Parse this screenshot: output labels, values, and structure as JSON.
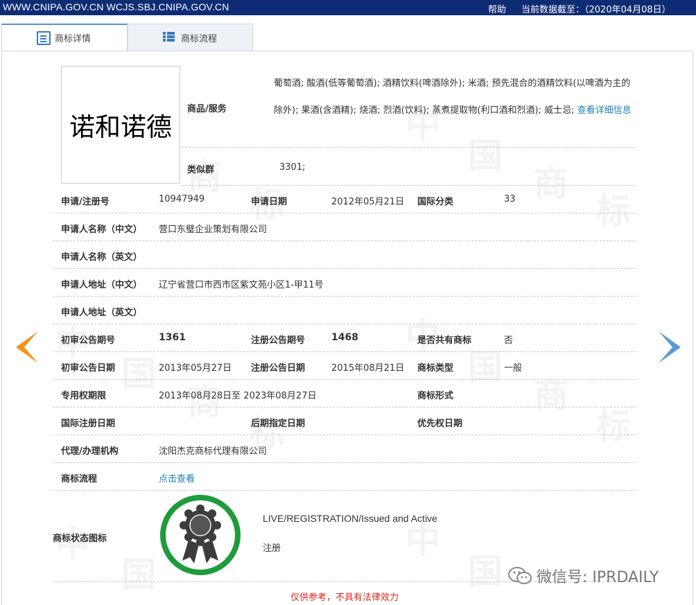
{
  "topbar": {
    "domain": "WWW.CNIPA.GOV.CN WCJS.SBJ.CNIPA.GOV.CN",
    "help": "帮助",
    "as_of": "当前数据截至：（2020年04月08日）"
  },
  "tabs": [
    {
      "label": "商标详情",
      "icon": "document-icon",
      "active": true
    },
    {
      "label": "商标流程",
      "icon": "list-icon",
      "active": false
    }
  ],
  "mark": {
    "text": "诺和诺德"
  },
  "goods": {
    "label": "商品/服务",
    "text": "葡萄酒; 酸酒(低等葡萄酒); 酒精饮料(啤酒除外); 米酒; 预先混合的酒精饮料(以啤酒为主的除外); 果酒(含酒精); 烧酒; 烈酒(饮料); 蒸煮提取物(利口酒和烈酒); 威士忌;",
    "more_link": "查看详细信息"
  },
  "similar_group": {
    "label": "类似群",
    "value": "3301;"
  },
  "fields": {
    "reg_no": {
      "label": "申请/注册号",
      "value": "10947949"
    },
    "app_date": {
      "label": "申请日期",
      "value": "2012年05月21日"
    },
    "intl_class": {
      "label": "国际分类",
      "value": "33"
    },
    "applicant_cn": {
      "label": "申请人名称（中文）",
      "value": "营口东璧企业策划有限公司"
    },
    "applicant_en": {
      "label": "申请人名称（英文）",
      "value": ""
    },
    "address_cn": {
      "label": "申请人地址（中文）",
      "value": "辽宁省营口市西市区紫文苑小区1-甲11号"
    },
    "address_en": {
      "label": "申请人地址（英文）",
      "value": ""
    },
    "prelim_pub_no": {
      "label": "初审公告期号",
      "value": "1361"
    },
    "reg_pub_no": {
      "label": "注册公告期号",
      "value": "1468"
    },
    "shared": {
      "label": "是否共有商标",
      "value": "否"
    },
    "prelim_pub_date": {
      "label": "初审公告日期",
      "value": "2013年05月27日"
    },
    "reg_pub_date": {
      "label": "注册公告日期",
      "value": "2015年08月21日"
    },
    "mark_type": {
      "label": "商标类型",
      "value": "一般"
    },
    "exclusive_period": {
      "label": "专用权期限",
      "value": "2013年08月28日至 2023年08月27日"
    },
    "mark_form": {
      "label": "商标形式",
      "value": ""
    },
    "intl_reg_date": {
      "label": "国际注册日期",
      "value": ""
    },
    "later_designation_date": {
      "label": "后期指定日期",
      "value": ""
    },
    "priority_date": {
      "label": "优先权日期",
      "value": ""
    },
    "agent": {
      "label": "代理/办理机构",
      "value": "沈阳杰克商标代理有限公司"
    },
    "process": {
      "label": "商标流程",
      "value": "点击查看"
    }
  },
  "status": {
    "label": "商标状态图标",
    "icon": "award-ribbon-icon",
    "line1": "LIVE/REGISTRATION/Issued and Active",
    "line2": "注册"
  },
  "watermark_chars": [
    "中",
    "国",
    "商",
    "标"
  ],
  "wechat": {
    "text": "微信号: IPRDAILY",
    "icon": "wechat-icon"
  },
  "disclaimer": "仅供参考，不具有法律效力",
  "colors": {
    "topbar": "#0e2c74",
    "link": "#1a7fb5",
    "arrow_left": "#f29418",
    "arrow_right": "#5b9bd5",
    "status_ring": "#1e9c3c",
    "disclaimer": "#d9261c"
  }
}
